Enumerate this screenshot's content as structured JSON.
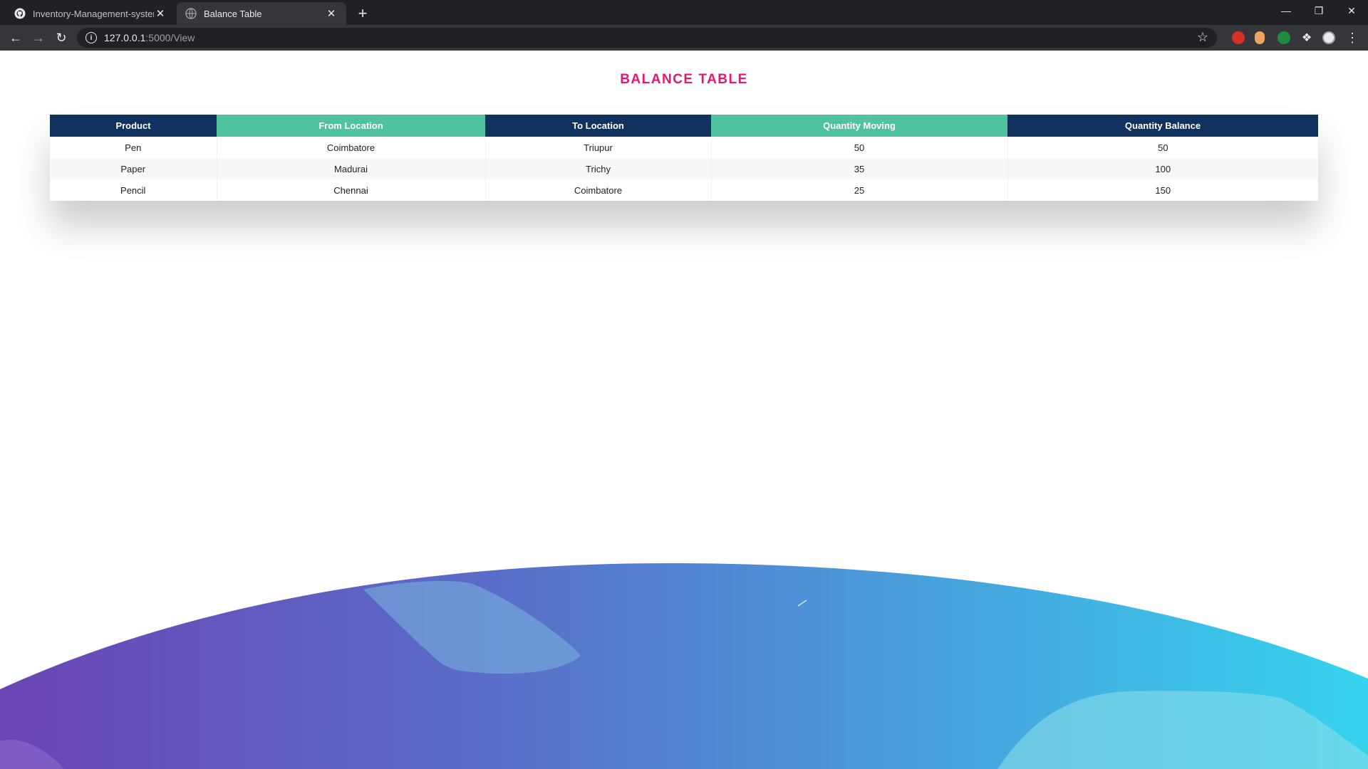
{
  "browser": {
    "tabs": [
      {
        "title": "Inventory-Management-system/",
        "active": false
      },
      {
        "title": "Balance Table",
        "active": true
      }
    ],
    "url_host": "127.0.0.1",
    "url_path": ":5000/View"
  },
  "page": {
    "title": "BALANCE TABLE"
  },
  "table": {
    "headers": [
      "Product",
      "From Location",
      "To Location",
      "Quantity Moving",
      "Quantity Balance"
    ],
    "rows": [
      [
        "Pen",
        "Coimbatore",
        "Triupur",
        "50",
        "50"
      ],
      [
        "Paper",
        "Madurai",
        "Trichy",
        "35",
        "100"
      ],
      [
        "Pencil",
        "Chennai",
        "Coimbatore",
        "25",
        "150"
      ]
    ]
  },
  "colors": {
    "title": "#e5176f",
    "header_dark": "#11325f",
    "header_green": "#4fc3a1"
  }
}
